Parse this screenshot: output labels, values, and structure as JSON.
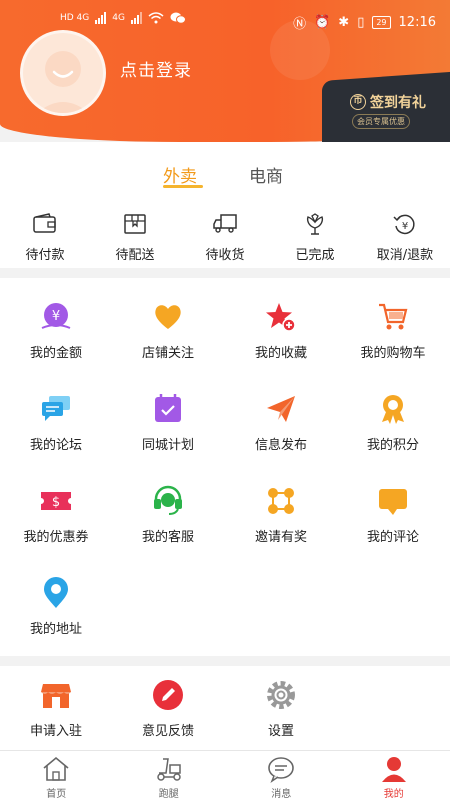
{
  "status_bar": {
    "time": "12:16",
    "battery": "29",
    "sim_labels": [
      "HD 4G",
      "4G"
    ]
  },
  "header": {
    "login_text": "点击登录",
    "signin_title": "签到有礼",
    "signin_sub": "会员专属优惠"
  },
  "order_tabs": [
    {
      "label": "外卖",
      "active": true
    },
    {
      "label": "电商",
      "active": false
    }
  ],
  "order_items": [
    {
      "label": "待付款",
      "icon": "wallet-icon"
    },
    {
      "label": "待配送",
      "icon": "package-icon"
    },
    {
      "label": "待收货",
      "icon": "truck-icon"
    },
    {
      "label": "已完成",
      "icon": "flower-icon"
    },
    {
      "label": "取消/退款",
      "icon": "refund-icon"
    }
  ],
  "grid_items": [
    {
      "label": "我的金额",
      "icon": "money-icon",
      "color": "#a259e6"
    },
    {
      "label": "店铺关注",
      "icon": "heart-icon",
      "color": "#f5a623"
    },
    {
      "label": "我的收藏",
      "icon": "star-icon",
      "color": "#e8303a"
    },
    {
      "label": "我的购物车",
      "icon": "cart-icon",
      "color": "#f2652b"
    },
    {
      "label": "我的论坛",
      "icon": "chat-icon",
      "color": "#2aa4e6"
    },
    {
      "label": "同城计划",
      "icon": "calendar-icon",
      "color": "#a259e6"
    },
    {
      "label": "信息发布",
      "icon": "paper-plane-icon",
      "color": "#f2652b"
    },
    {
      "label": "我的积分",
      "icon": "medal-icon",
      "color": "#f5a623"
    },
    {
      "label": "我的优惠券",
      "icon": "coupon-icon",
      "color": "#e8305a"
    },
    {
      "label": "我的客服",
      "icon": "headset-icon",
      "color": "#2bb34a"
    },
    {
      "label": "邀请有奖",
      "icon": "nodes-icon",
      "color": "#f5a623"
    },
    {
      "label": "我的评论",
      "icon": "comment-icon",
      "color": "#f5a623"
    },
    {
      "label": "我的地址",
      "icon": "location-icon",
      "color": "#2aa4e6"
    }
  ],
  "settings_items": [
    {
      "label": "申请入驻",
      "icon": "shop-icon",
      "color": "#f2652b"
    },
    {
      "label": "意见反馈",
      "icon": "pencil-icon",
      "color": "#e8303a"
    },
    {
      "label": "设置",
      "icon": "gear-icon",
      "color": "#999999"
    }
  ],
  "bottom_nav": [
    {
      "label": "首页",
      "icon": "home-icon",
      "active": false
    },
    {
      "label": "跑腿",
      "icon": "scooter-icon",
      "active": false
    },
    {
      "label": "消息",
      "icon": "message-icon",
      "active": false
    },
    {
      "label": "我的",
      "icon": "person-icon",
      "active": true
    }
  ],
  "colors": {
    "header_orange": "#f7622a",
    "tab_active": "#f29a1a",
    "nav_active": "#e53935"
  }
}
